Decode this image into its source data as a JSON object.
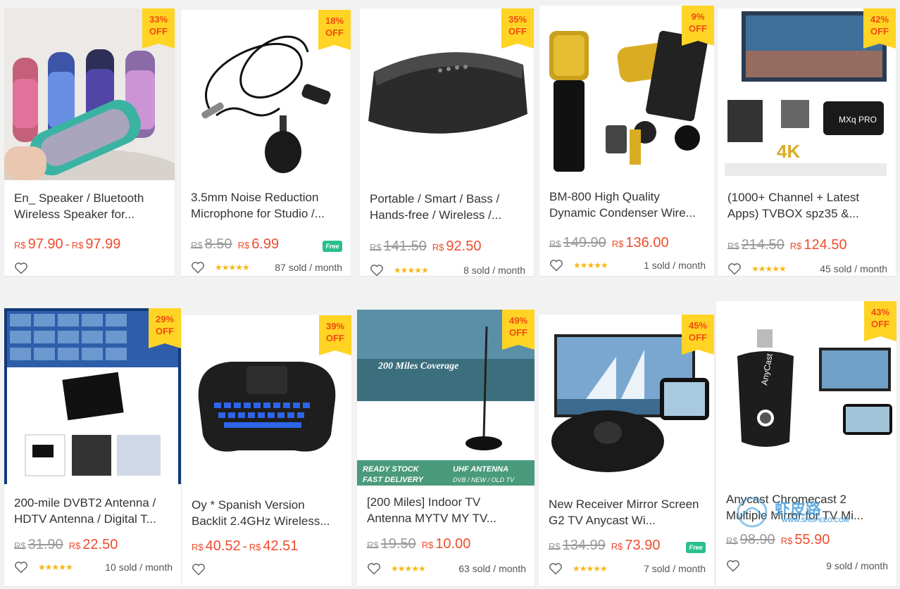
{
  "products": [
    {
      "discount": "33%",
      "off": "OFF",
      "title": "En_ Speaker / Bluetooth Wireless Speaker for...",
      "price_old": "",
      "price": "97.90",
      "price_max": "97.99",
      "currency": "R$",
      "sold": "",
      "free": false,
      "stars": false,
      "image": "led-speakers-photo"
    },
    {
      "discount": "18%",
      "off": "OFF",
      "title": "3.5mm Noise Reduction Microphone for Studio /...",
      "price_old": "8.50",
      "price": "6.99",
      "price_max": "",
      "currency": "R$",
      "sold": "87 sold / month",
      "free": true,
      "stars": true,
      "image": "lavalier-microphone-photo"
    },
    {
      "discount": "35%",
      "off": "OFF",
      "title": "Portable / Smart / Bass / Hands-free / Wireless /...",
      "price_old": "141.50",
      "price": "92.50",
      "price_max": "",
      "currency": "R$",
      "sold": "8 sold / month",
      "free": false,
      "stars": true,
      "image": "bar-speaker-photo"
    },
    {
      "discount": "9%",
      "off": "OFF",
      "title": "BM-800 High Quality Dynamic Condenser Wire...",
      "price_old": "149.90",
      "price": "136.00",
      "price_max": "",
      "currency": "R$",
      "sold": "1 sold / month",
      "free": false,
      "stars": true,
      "image": "condenser-mic-photo"
    },
    {
      "discount": "42%",
      "off": "OFF",
      "title": "(1000+ Channel + Latest Apps) TVBOX spz35 &...",
      "price_old": "214.50",
      "price": "124.50",
      "price_max": "",
      "currency": "R$",
      "sold": "45 sold / month",
      "free": false,
      "stars": true,
      "image": "tv-box-photo"
    },
    {
      "discount": "29%",
      "off": "OFF",
      "title": "200-mile DVBT2 Antenna / HDTV Antenna / Digital T...",
      "price_old": "31.90",
      "price": "22.50",
      "price_max": "",
      "currency": "R$",
      "sold": "10 sold / month",
      "free": false,
      "stars": true,
      "image": "flat-antenna-photo"
    },
    {
      "discount": "39%",
      "off": "OFF",
      "title": "Oy * Spanish Version Backlit 2.4GHz Wireless...",
      "price_old": "",
      "price": "40.52",
      "price_max": "42.51",
      "currency": "R$",
      "sold": "",
      "free": false,
      "stars": false,
      "image": "wireless-keyboard-photo"
    },
    {
      "discount": "49%",
      "off": "OFF",
      "title": "[200 Miles] Indoor TV Antenna MYTV MY TV...",
      "price_old": "19.50",
      "price": "10.00",
      "price_max": "",
      "currency": "R$",
      "sold": "63 sold / month",
      "free": false,
      "stars": true,
      "image": "indoor-antenna-photo"
    },
    {
      "discount": "45%",
      "off": "OFF",
      "title": "New Receiver Mirror Screen G2 TV Anycast Wi...",
      "price_old": "134.99",
      "price": "73.90",
      "price_max": "",
      "currency": "R$",
      "sold": "7 sold / month",
      "free": true,
      "stars": true,
      "image": "mirror-receiver-photo"
    },
    {
      "discount": "43%",
      "off": "OFF",
      "title": "Anycast Chromecast 2 Multiple Mirror for TV Mi...",
      "price_old": "98.90",
      "price": "55.90",
      "price_max": "",
      "currency": "R$",
      "sold": "9 sold / month",
      "free": false,
      "stars": false,
      "image": "anycast-dongle-photo"
    }
  ],
  "image_text": {
    "tvbox_brand": "MXq PRO",
    "tvbox_4k": "4K",
    "antenna_coverage": "200 Miles Coverage",
    "antenna_banner_1": "READY STOCK",
    "antenna_banner_2": "FAST DELIVERY",
    "antenna_banner_3": "UHF ANTENNA",
    "antenna_banner_4": "DVB / NEW / OLD TV",
    "anycast_label": "AnyCast"
  },
  "free_label": "Free",
  "stars_glyph": "★★★★★",
  "watermark": {
    "main": "虾皮路",
    "sub": "WWW.SHOPEEO.COM"
  },
  "colors": {
    "price": "#ee4d2d",
    "badge": "#ffd424",
    "badge_text": "#f24a12",
    "stars": "#f6b816",
    "free": "#2bbf8b"
  }
}
